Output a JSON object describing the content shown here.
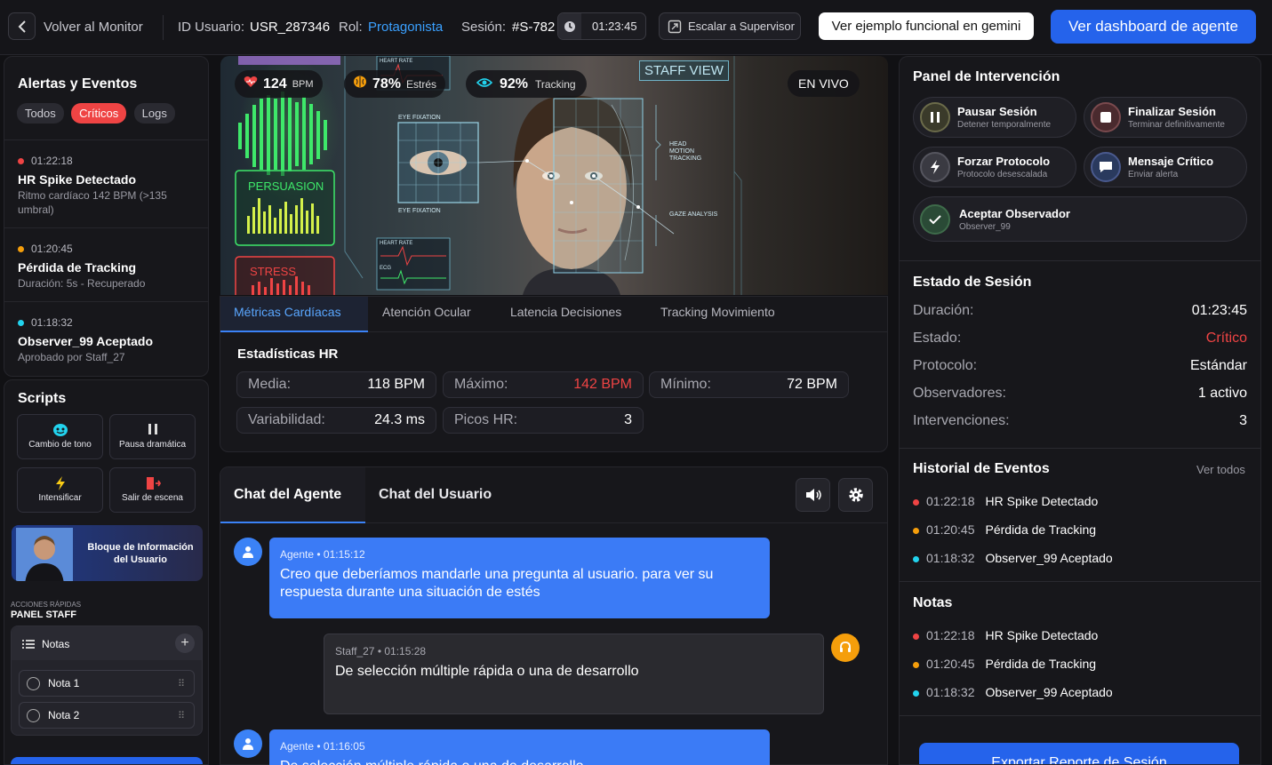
{
  "topbar": {
    "back_label": "Volver al Monitor",
    "user_id_label": "ID Usuario:",
    "user_id": "USR_287346",
    "role_label": "Rol:",
    "role": "Protagonista",
    "session_label": "Sesión:",
    "session": "#S-782",
    "timer": "01:23:45",
    "escalate_label": "Escalar a Supervisor",
    "example_label": "Ver ejemplo funcional en gemini",
    "dashboard_label": "Ver dashboard de agente"
  },
  "alerts": {
    "title": "Alertas y Eventos",
    "filters": [
      "Todos",
      "Críticos",
      "Logs"
    ],
    "items": [
      {
        "time": "01:22:18",
        "title": "HR Spike Detectado",
        "desc": "Ritmo cardíaco 142 BPM (>135 umbral)",
        "color": "#ef4444"
      },
      {
        "time": "01:20:45",
        "title": "Pérdida de Tracking",
        "desc": "Duración: 5s - Recuperado",
        "color": "#f59e0b"
      },
      {
        "time": "01:18:32",
        "title": "Observer_99 Aceptado",
        "desc": "Aprobado por Staff_27",
        "color": "#22d3ee"
      }
    ]
  },
  "scripts": {
    "title": "Scripts",
    "items": [
      "Cambio de tono",
      "Pausa dramática",
      "Intensificar",
      "Salir de escena"
    ],
    "user_block": "Bloque de Información del Usuario",
    "quick_label": "ACCIONES RÁPIDAS",
    "staff_panel": "PANEL STAFF",
    "notes_title": "Notas",
    "notes": [
      "Nota 1",
      "Nota 2"
    ]
  },
  "video": {
    "bpm": "124",
    "bpm_unit": "BPM",
    "stress": "78%",
    "stress_label": "Estrés",
    "tracking": "92%",
    "tracking_label": "Tracking",
    "staff_view": "STAFF VIEW",
    "live": "EN VIVO",
    "persuasion": "PERSUASION",
    "stress_panel": "STRESS",
    "heart_rate": "HEART RATE",
    "eye_fixation": "EYE FIXATION",
    "head_motion": "HEAD MOTION TRACKING",
    "gaze": "GAZE ANALYSIS",
    "ecg": "ECG"
  },
  "tabs": [
    "Métricas Cardíacas",
    "Atención Ocular",
    "Latencia Decisiones",
    "Tracking Movimiento"
  ],
  "hr_stats": {
    "title": "Estadísticas HR",
    "media_label": "Media:",
    "media": "118 BPM",
    "max_label": "Máximo:",
    "max": "142 BPM",
    "min_label": "Mínimo:",
    "min": "72 BPM",
    "var_label": "Variabilidad:",
    "var": "24.3 ms",
    "peaks_label": "Picos HR:",
    "peaks": "3"
  },
  "chat": {
    "tab_agent": "Chat del Agente",
    "tab_user": "Chat del Usuario",
    "messages": [
      {
        "meta": "Agente • 01:15:12",
        "text": "Creo que deberíamos mandarle una pregunta al usuario. para ver su respuesta durante una situación de estés"
      },
      {
        "meta": "Staff_27 • 01:15:28",
        "text": "De selección múltiple rápida o una de desarrollo"
      },
      {
        "meta": "Agente • 01:16:05",
        "text": "De selección múltiple rápida o una de desarrollo"
      }
    ]
  },
  "intervention": {
    "title": "Panel de Intervención",
    "pause": "Pausar Sesión",
    "pause_sub": "Detener temporalmente",
    "end": "Finalizar Sesión",
    "end_sub": "Terminar definitivamente",
    "force": "Forzar Protocolo",
    "force_sub": "Protocolo desescalada",
    "msg": "Mensaje Crítico",
    "msg_sub": "Enviar alerta",
    "accept": "Aceptar Observador",
    "accept_sub": "Observer_99"
  },
  "status": {
    "title": "Estado de Sesión",
    "rows": [
      {
        "k": "Duración:",
        "v": "01:23:45"
      },
      {
        "k": "Estado:",
        "v": "Crítico"
      },
      {
        "k": "Protocolo:",
        "v": "Estándar"
      },
      {
        "k": "Observadores:",
        "v": "1 activo"
      },
      {
        "k": "Intervenciones:",
        "v": "3"
      }
    ]
  },
  "history": {
    "title": "Historial de Eventos",
    "see_all": "Ver todos",
    "rows": [
      {
        "t": "01:22:18",
        "e": "HR Spike Detectado"
      },
      {
        "t": "01:20:45",
        "e": "Pérdida de Tracking"
      },
      {
        "t": "01:18:32",
        "e": "Observer_99 Aceptado"
      }
    ]
  },
  "notes_panel": {
    "title": "Notas",
    "rows": [
      {
        "t": "01:22:18",
        "e": "HR Spike Detectado"
      },
      {
        "t": "01:20:45",
        "e": "Pérdida de Tracking"
      },
      {
        "t": "01:18:32",
        "e": "Observer_99 Aceptado"
      }
    ]
  },
  "export_label": "Exportar Reporte de Sesión",
  "colors": {
    "accent": "#2563eb",
    "critical": "#ef4444",
    "warning": "#f59e0b",
    "info": "#22d3ee",
    "success": "#22c55e"
  }
}
